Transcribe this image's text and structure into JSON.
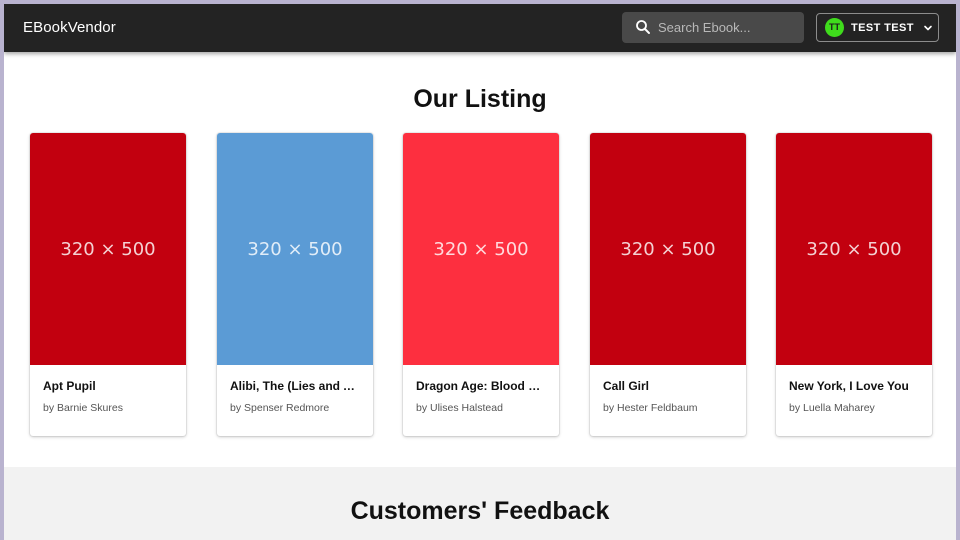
{
  "navbar": {
    "brand": "EBookVendor",
    "search": {
      "placeholder": "Search Ebook..."
    },
    "user": {
      "initials": "TT",
      "name": "TEST TEST"
    }
  },
  "listing": {
    "title": "Our Listing",
    "books": [
      {
        "cover_text": "320 × 500",
        "cover_color": "#c2000f",
        "title": "Apt Pupil",
        "author": "by Barnie Skures"
      },
      {
        "cover_text": "320 × 500",
        "cover_color": "#5b9bd5",
        "title": "Alibi, The (Lies and Alibis)",
        "author": "by Spenser Redmore"
      },
      {
        "cover_text": "320 × 500",
        "cover_color": "#fd2f3f",
        "title": "Dragon Age: Blood mage no seisen",
        "author": "by Ulises Halstead"
      },
      {
        "cover_text": "320 × 500",
        "cover_color": "#c2000f",
        "title": "Call Girl",
        "author": "by Hester Feldbaum"
      },
      {
        "cover_text": "320 × 500",
        "cover_color": "#c2000f",
        "title": "New York, I Love You",
        "author": "by Luella Maharey"
      }
    ]
  },
  "feedback": {
    "title": "Customers' Feedback"
  },
  "colors": {
    "navbar": "#232323",
    "avatar": "#3fdc1c",
    "feedback_bg": "#f2f2f2"
  }
}
